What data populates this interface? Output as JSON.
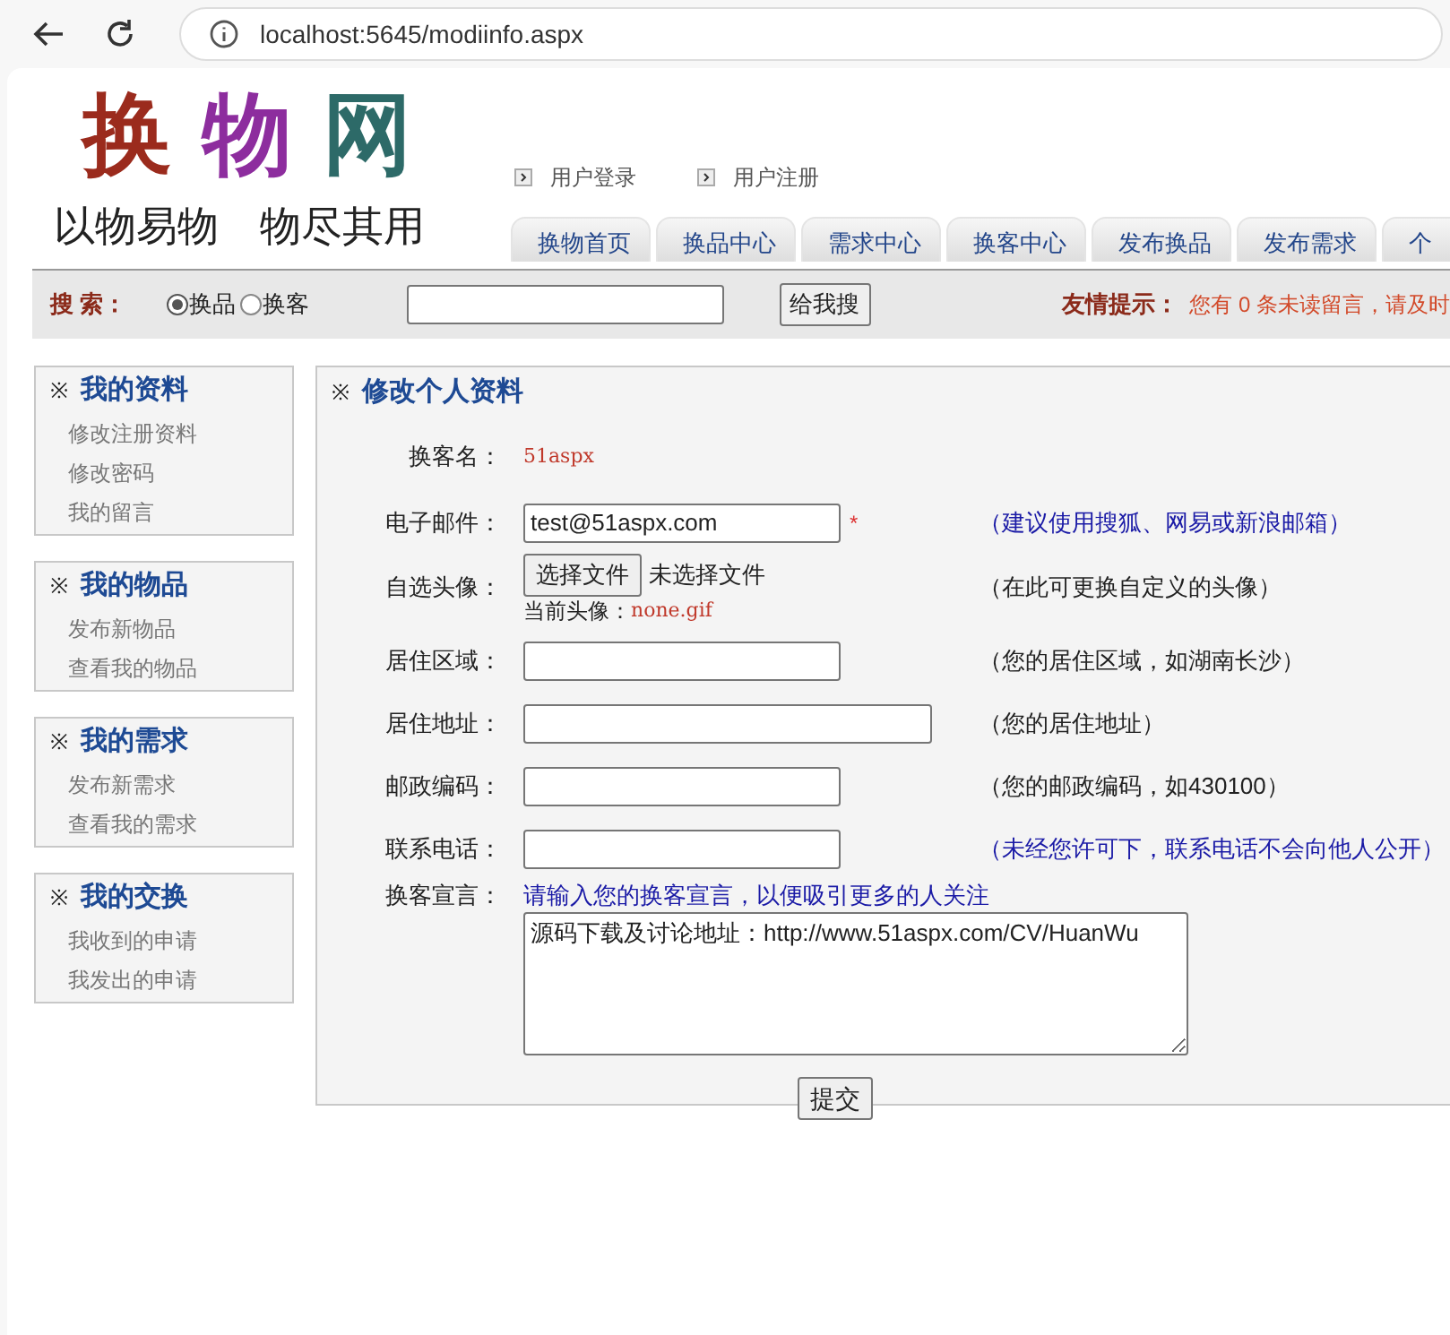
{
  "browser": {
    "url": "localhost:5645/modiinfo.aspx"
  },
  "logo": {
    "chars": [
      {
        "text": "换",
        "color": "#9b2b1d"
      },
      {
        "text": "物",
        "color": "#8d2d9e"
      },
      {
        "text": "网",
        "color": "#2d6a68"
      }
    ],
    "slogan": "以物易物　物尽其用"
  },
  "user_links": [
    "用户登录",
    "用户注册"
  ],
  "nav_tabs": [
    "换物首页",
    "换品中心",
    "需求中心",
    "换客中心",
    "发布换品",
    "发布需求",
    "个"
  ],
  "search": {
    "label": "搜 索：",
    "options": [
      {
        "label": "换品",
        "selected": true
      },
      {
        "label": "换客",
        "selected": false
      }
    ],
    "button": "给我搜"
  },
  "tip": {
    "label": "友情提示：",
    "text": "您有 0 条未读留言，请及时"
  },
  "sidebar": [
    {
      "mark": "※",
      "title": "我的资料",
      "items": [
        "修改注册资料",
        "修改密码",
        "我的留言"
      ]
    },
    {
      "mark": "※",
      "title": "我的物品",
      "items": [
        "发布新物品",
        "查看我的物品"
      ]
    },
    {
      "mark": "※",
      "title": "我的需求",
      "items": [
        "发布新需求",
        "查看我的需求"
      ]
    },
    {
      "mark": "※",
      "title": "我的交换",
      "items": [
        "我收到的申请",
        "我发出的申请"
      ]
    }
  ],
  "main": {
    "mark": "※",
    "title": "修改个人资料",
    "fields": [
      {
        "kind": "static",
        "label": "换客名：",
        "value": "51aspx"
      },
      {
        "kind": "input",
        "label": "电子邮件：",
        "value": "test@51aspx.com",
        "required_mark": "*",
        "hint": "（建议使用搜狐、网易或新浪邮箱）",
        "highlight": true
      },
      {
        "kind": "file",
        "label": "自选头像：",
        "button": "选择文件",
        "status": "未选择文件",
        "current_label": "当前头像：",
        "current_value": "none.gif",
        "hint": "（在此可更换自定义的头像）",
        "highlight": false
      },
      {
        "kind": "input",
        "label": "居住区域：",
        "hint": "（您的居住区域，如湖南长沙）",
        "highlight": false,
        "wide": false
      },
      {
        "kind": "input",
        "label": "居住地址：",
        "hint": "（您的居住地址）",
        "highlight": false,
        "wide": true
      },
      {
        "kind": "input",
        "label": "邮政编码：",
        "hint": "（您的邮政编码，如430100）",
        "highlight": false,
        "wide": false
      },
      {
        "kind": "input",
        "label": "联系电话：",
        "hint": "（未经您许可下，联系电话不会向他人公开）",
        "highlight": true,
        "wide": false
      },
      {
        "kind": "textarea",
        "label": "换客宣言：",
        "note": "请输入您的换客宣言，以便吸引更多的人关注",
        "value": "源码下载及讨论地址：http://www.51aspx.com/CV/HuanWu"
      }
    ],
    "submit": "提交"
  }
}
